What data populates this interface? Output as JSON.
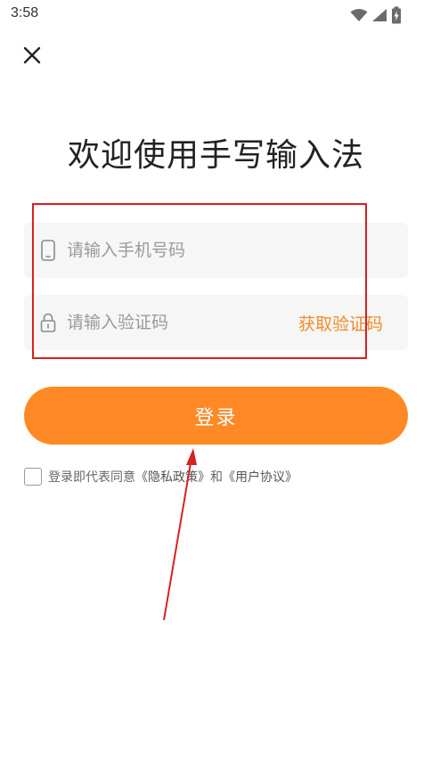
{
  "status_bar": {
    "time": "3:58",
    "icons": [
      "wifi-icon",
      "cellular-signal-icon",
      "battery-charging-icon"
    ]
  },
  "header": {
    "close_icon": "close-icon"
  },
  "main": {
    "title": "欢迎使用手写输入法",
    "phone_field": {
      "placeholder": "请输入手机号码",
      "value": "",
      "icon": "phone-icon"
    },
    "code_field": {
      "placeholder": "请输入验证码",
      "value": "",
      "icon": "lock-icon"
    },
    "get_code_label": "获取验证码",
    "login_label": "登录",
    "agreement": {
      "checked": false,
      "prefix": "登录即代表同意",
      "privacy_link": "《隐私政策》",
      "conjunction": "和",
      "user_agreement_link": "《用户协议》"
    }
  },
  "colors": {
    "accent": "#ff8a25",
    "accent_text": "#f28a25",
    "field_background": "#f6f6f6",
    "annotation_red": "#d82020"
  }
}
